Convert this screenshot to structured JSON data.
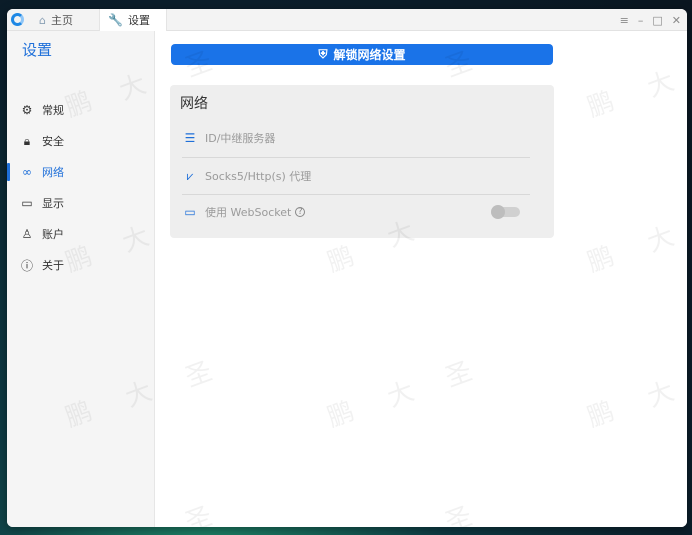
{
  "window": {
    "tabs": [
      {
        "label": "主页",
        "icon": "home-icon"
      },
      {
        "label": "设置",
        "icon": "wrench-icon"
      }
    ],
    "controls": [
      "menu-icon",
      "minimize-icon",
      "maximize-icon",
      "close-icon"
    ]
  },
  "sidebar": {
    "title": "设置",
    "items": [
      {
        "label": "常规",
        "icon": "gear-icon"
      },
      {
        "label": "安全",
        "icon": "lock-icon"
      },
      {
        "label": "网络",
        "icon": "link-icon",
        "active": true
      },
      {
        "label": "显示",
        "icon": "monitor-icon"
      },
      {
        "label": "账户",
        "icon": "user-icon"
      },
      {
        "label": "关于",
        "icon": "info-icon"
      }
    ]
  },
  "main": {
    "unlock_button": "解锁网络设置",
    "network": {
      "title": "网络",
      "rows": [
        {
          "label": "ID/中继服务器",
          "icon": "server-icon"
        },
        {
          "label": "Socks5/Http(s) 代理",
          "icon": "proxy-icon"
        },
        {
          "label": "使用 WebSocket",
          "icon": "websocket-icon"
        }
      ],
      "websocket_enabled": false
    }
  },
  "watermark": [
    "鹏",
    "大",
    "圣"
  ],
  "colors": {
    "accent": "#1a73e8",
    "sidebar_bg": "#f5f5f5",
    "card_bg": "#eeeeee"
  }
}
